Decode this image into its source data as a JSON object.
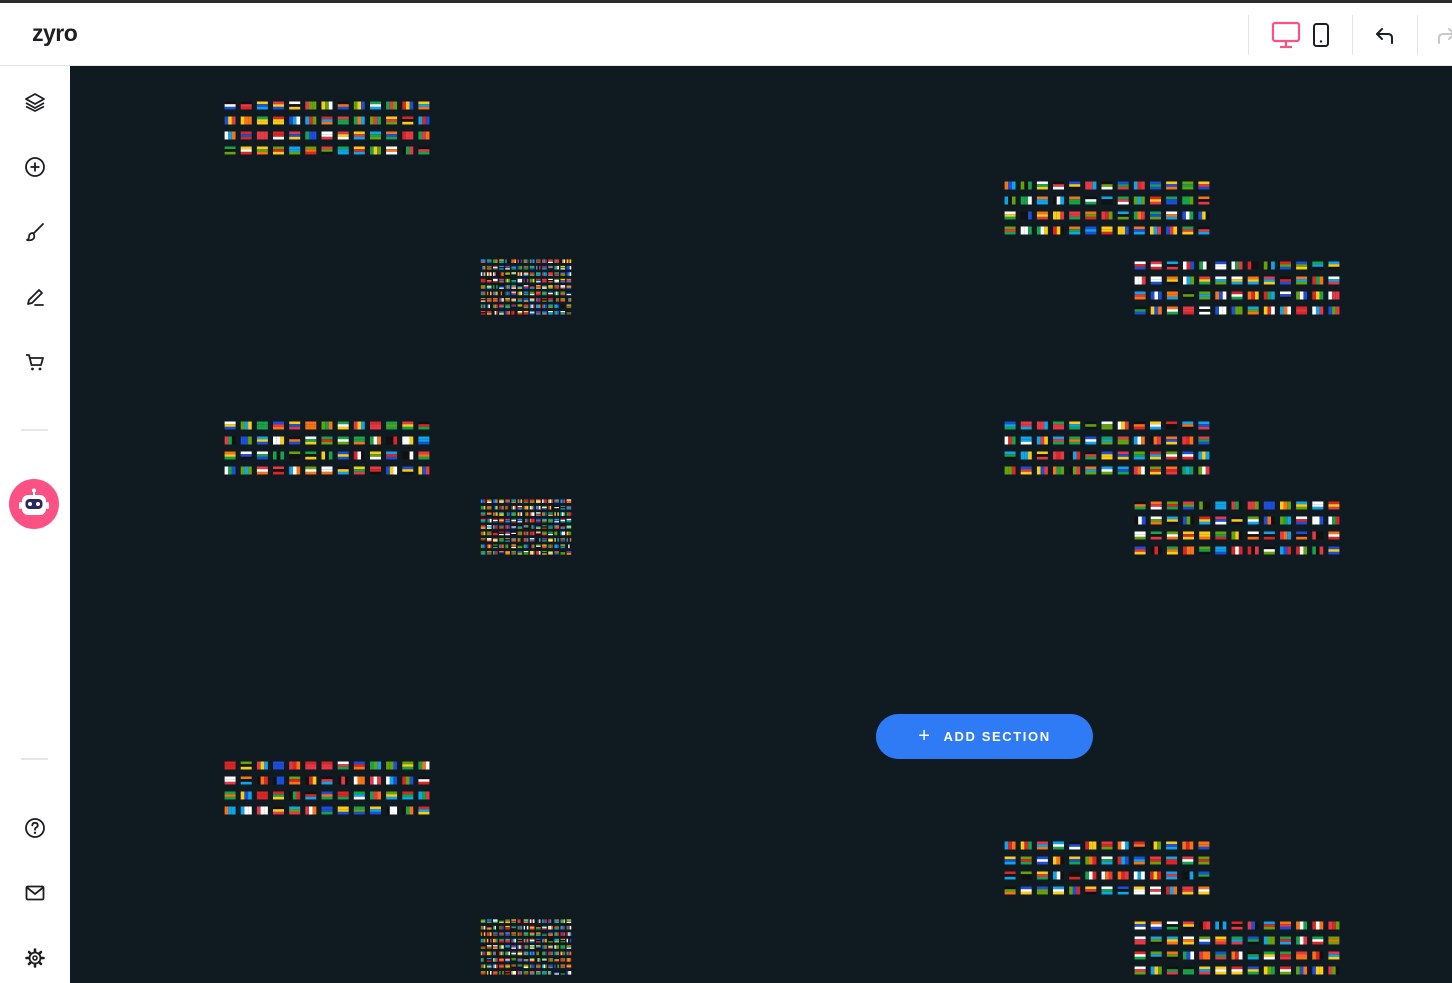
{
  "app": {
    "logo": "zyro"
  },
  "toolbar": {
    "desktop_view": "desktop-view",
    "mobile_view": "mobile-view",
    "undo": "undo",
    "redo": "redo",
    "active_color": "#fc5185"
  },
  "sidebar": {
    "items": [
      {
        "icon": "layers-icon"
      },
      {
        "icon": "add-element-icon"
      },
      {
        "icon": "brush-icon"
      },
      {
        "icon": "pen-icon"
      },
      {
        "icon": "cart-icon"
      },
      {
        "icon": "ai-assistant-icon"
      },
      {
        "icon": "help-icon"
      },
      {
        "icon": "mail-icon"
      },
      {
        "icon": "settings-icon"
      }
    ]
  },
  "canvas": {
    "background": "#101b21",
    "add_section_label": "ADD SECTION",
    "add_section_color": "#2f7bf5",
    "flag_tiles": "flags-pattern"
  }
}
